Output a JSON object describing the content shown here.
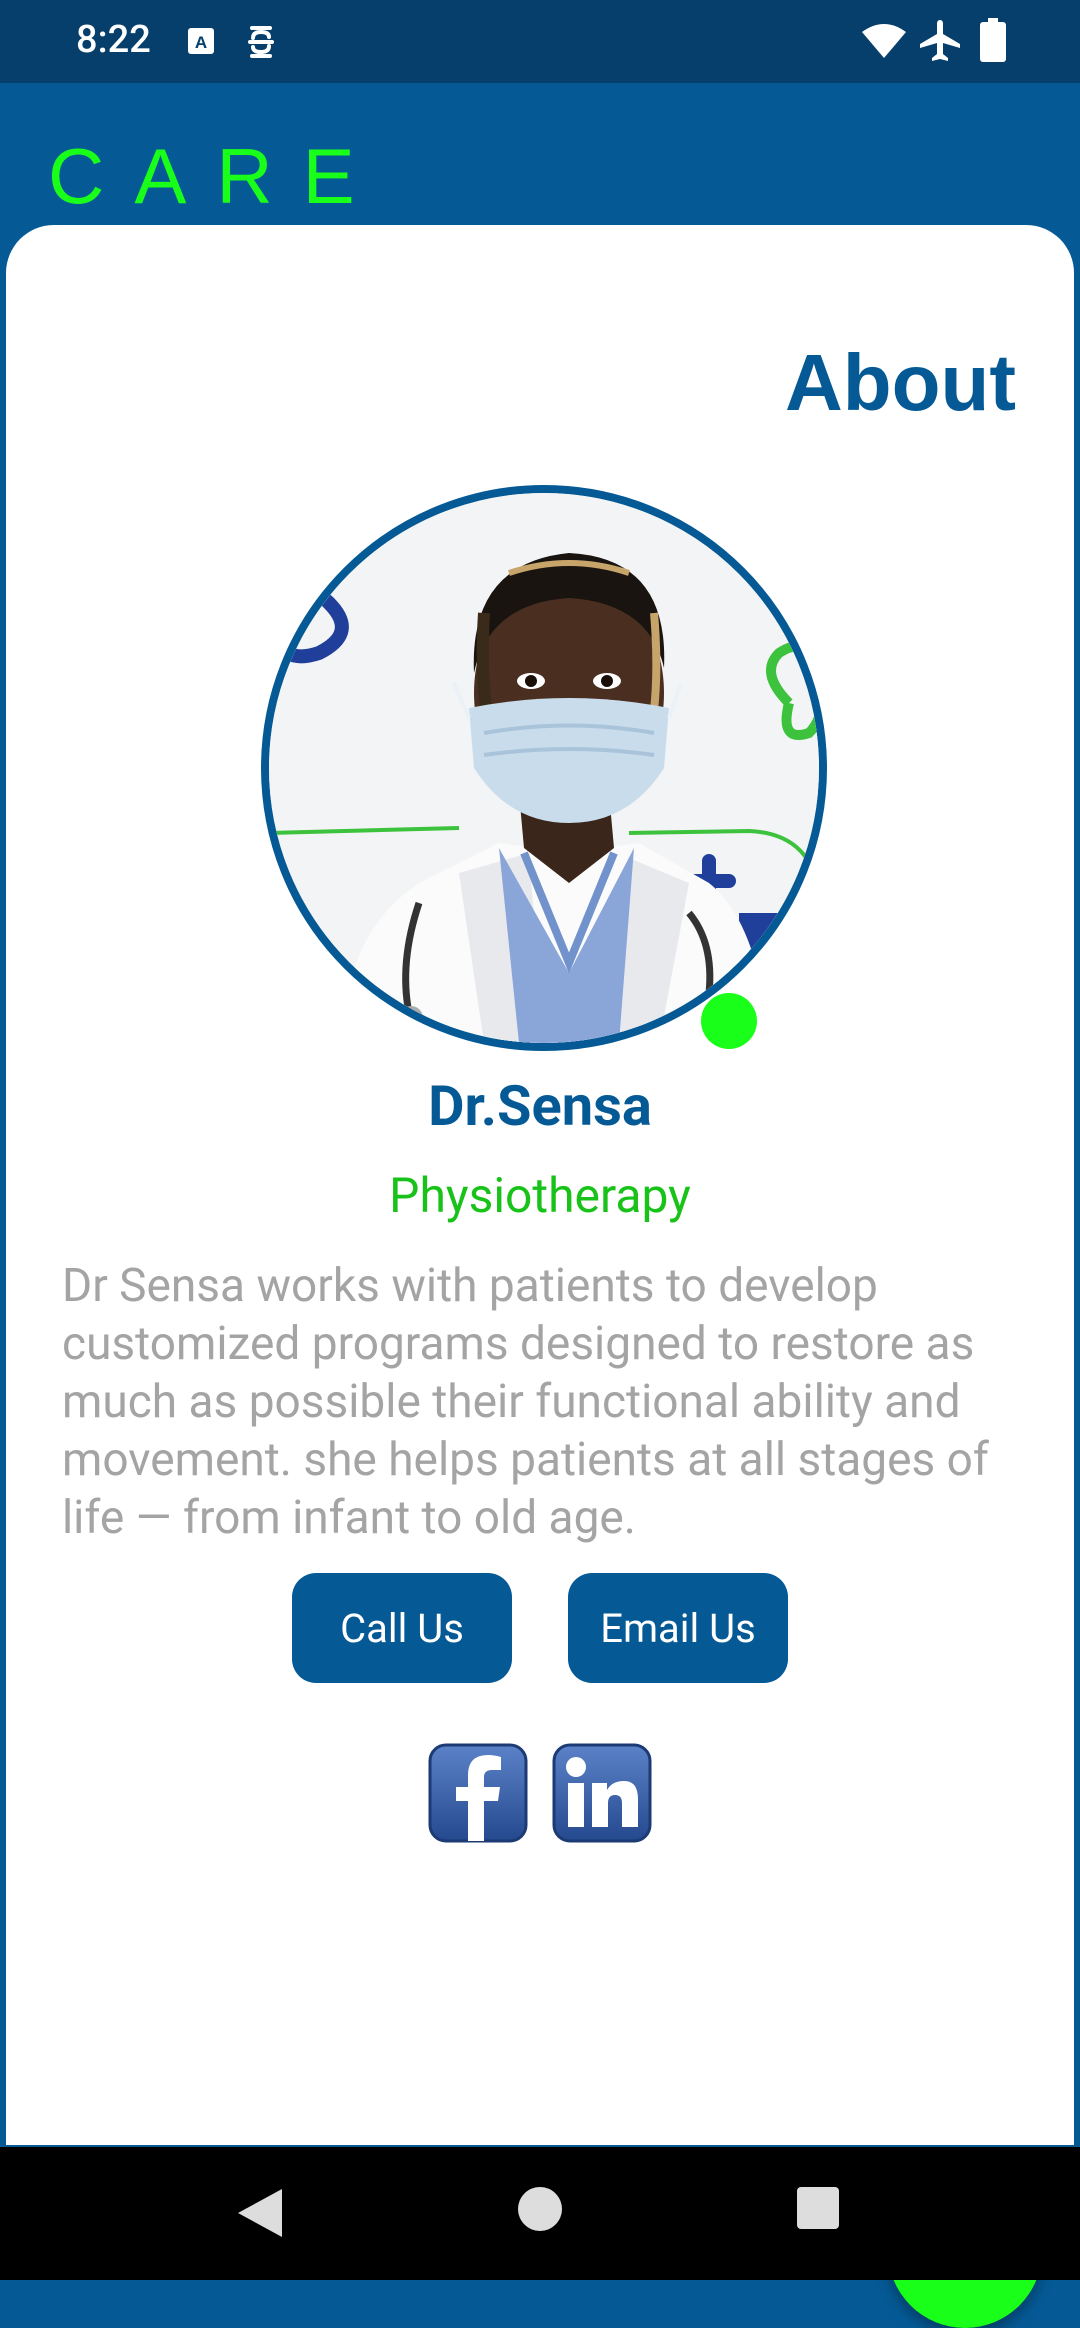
{
  "status_bar": {
    "time": "8:22"
  },
  "header": {
    "brand": "CARE"
  },
  "page": {
    "title": "About"
  },
  "profile": {
    "name": "Dr.Sensa",
    "specialty": "Physiotherapy",
    "description": "Dr Sensa works with patients to develop customized programs designed to restore as much as possible their functional ability and movement. she helps patients at all stages of life — from infant to old age.",
    "online": true
  },
  "actions": {
    "call_label": "Call Us",
    "email_label": "Email Us"
  },
  "social": {
    "facebook_icon": "facebook-icon",
    "linkedin_icon": "linkedin-icon"
  },
  "fab": {
    "icon": "menu-icon"
  },
  "colors": {
    "primary": "#055a96",
    "accent": "#19ff19",
    "specialty": "#19c219",
    "muted_text": "#a4a4a4"
  }
}
